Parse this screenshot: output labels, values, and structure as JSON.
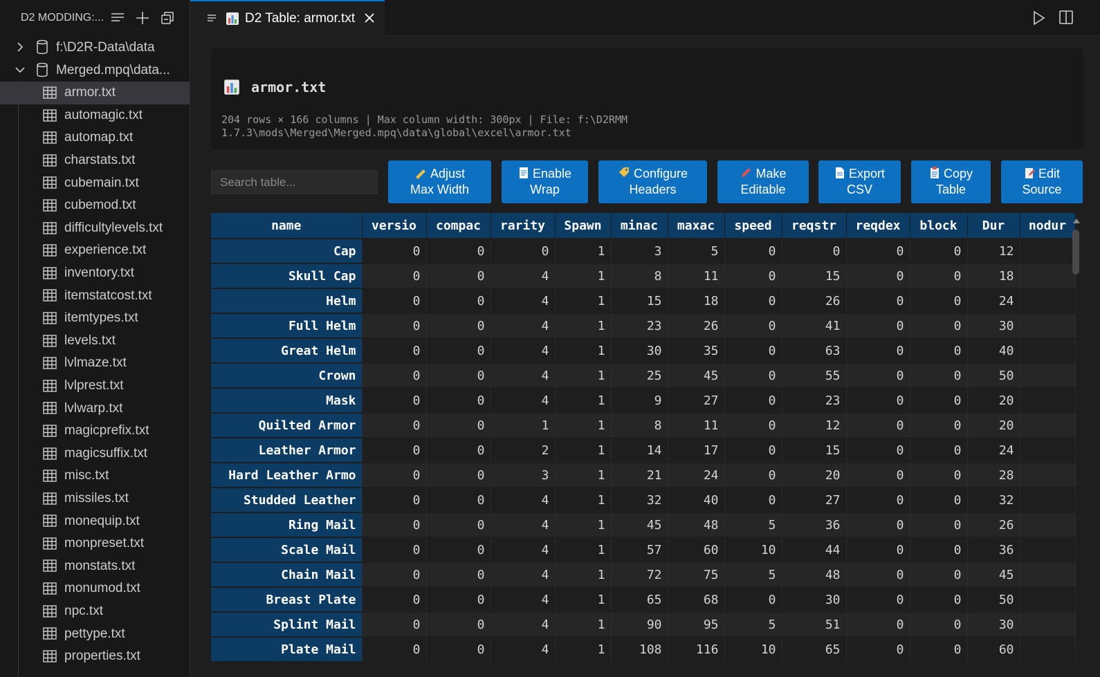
{
  "sidebar": {
    "title": "D2 MODDING:...",
    "roots": [
      {
        "label": "f:\\D2R-Data\\data",
        "expanded": false
      },
      {
        "label": "Merged.mpq\\data...",
        "expanded": true
      }
    ],
    "files": [
      "armor.txt",
      "automagic.txt",
      "automap.txt",
      "charstats.txt",
      "cubemain.txt",
      "cubemod.txt",
      "difficultylevels.txt",
      "experience.txt",
      "inventory.txt",
      "itemstatcost.txt",
      "itemtypes.txt",
      "levels.txt",
      "lvlmaze.txt",
      "lvlprest.txt",
      "lvlwarp.txt",
      "magicprefix.txt",
      "magicsuffix.txt",
      "misc.txt",
      "missiles.txt",
      "monequip.txt",
      "monpreset.txt",
      "monstats.txt",
      "monumod.txt",
      "npc.txt",
      "pettype.txt",
      "properties.txt"
    ],
    "selected": "armor.txt"
  },
  "tab": {
    "label": "D2 Table: armor.txt"
  },
  "info": {
    "title": "armor.txt",
    "meta_line1": "204 rows × 166 columns | Max column width: 300px | File: f:\\D2RMM",
    "meta_line2": "1.7.3\\mods\\Merged\\Merged.mpq\\data\\global\\excel\\armor.txt"
  },
  "search": {
    "placeholder": "Search table..."
  },
  "buttons": [
    {
      "line1": "Adjust",
      "line2": "Max Width"
    },
    {
      "line1": "Enable",
      "line2": "Wrap"
    },
    {
      "line1": "Configure",
      "line2": "Headers"
    },
    {
      "line1": "Make",
      "line2": "Editable"
    },
    {
      "line1": "Export",
      "line2": "CSV"
    },
    {
      "line1": "Copy",
      "line2": "Table"
    },
    {
      "line1": "Edit",
      "line2": "Source"
    }
  ],
  "table": {
    "headers": [
      "name",
      "versio",
      "compac",
      "rarity",
      "Spawn",
      "minac",
      "maxac",
      "speed",
      "reqstr",
      "reqdex",
      "block",
      "Dur",
      "nodur"
    ],
    "rows": [
      [
        "Cap",
        "0",
        "0",
        "0",
        "1",
        "3",
        "5",
        "0",
        "0",
        "0",
        "0",
        "12",
        ""
      ],
      [
        "Skull Cap",
        "0",
        "0",
        "4",
        "1",
        "8",
        "11",
        "0",
        "15",
        "0",
        "0",
        "18",
        ""
      ],
      [
        "Helm",
        "0",
        "0",
        "4",
        "1",
        "15",
        "18",
        "0",
        "26",
        "0",
        "0",
        "24",
        ""
      ],
      [
        "Full Helm",
        "0",
        "0",
        "4",
        "1",
        "23",
        "26",
        "0",
        "41",
        "0",
        "0",
        "30",
        ""
      ],
      [
        "Great Helm",
        "0",
        "0",
        "4",
        "1",
        "30",
        "35",
        "0",
        "63",
        "0",
        "0",
        "40",
        ""
      ],
      [
        "Crown",
        "0",
        "0",
        "4",
        "1",
        "25",
        "45",
        "0",
        "55",
        "0",
        "0",
        "50",
        ""
      ],
      [
        "Mask",
        "0",
        "0",
        "4",
        "1",
        "9",
        "27",
        "0",
        "23",
        "0",
        "0",
        "20",
        ""
      ],
      [
        "Quilted Armor",
        "0",
        "0",
        "1",
        "1",
        "8",
        "11",
        "0",
        "12",
        "0",
        "0",
        "20",
        ""
      ],
      [
        "Leather Armor",
        "0",
        "0",
        "2",
        "1",
        "14",
        "17",
        "0",
        "15",
        "0",
        "0",
        "24",
        ""
      ],
      [
        "Hard Leather Armo",
        "0",
        "0",
        "3",
        "1",
        "21",
        "24",
        "0",
        "20",
        "0",
        "0",
        "28",
        ""
      ],
      [
        "Studded Leather",
        "0",
        "0",
        "4",
        "1",
        "32",
        "40",
        "0",
        "27",
        "0",
        "0",
        "32",
        ""
      ],
      [
        "Ring Mail",
        "0",
        "0",
        "4",
        "1",
        "45",
        "48",
        "5",
        "36",
        "0",
        "0",
        "26",
        ""
      ],
      [
        "Scale Mail",
        "0",
        "0",
        "4",
        "1",
        "57",
        "60",
        "10",
        "44",
        "0",
        "0",
        "36",
        ""
      ],
      [
        "Chain Mail",
        "0",
        "0",
        "4",
        "1",
        "72",
        "75",
        "5",
        "48",
        "0",
        "0",
        "45",
        ""
      ],
      [
        "Breast Plate",
        "0",
        "0",
        "4",
        "1",
        "65",
        "68",
        "0",
        "30",
        "0",
        "0",
        "50",
        ""
      ],
      [
        "Splint Mail",
        "0",
        "0",
        "4",
        "1",
        "90",
        "95",
        "5",
        "51",
        "0",
        "0",
        "30",
        ""
      ],
      [
        "Plate Mail",
        "0",
        "0",
        "4",
        "1",
        "108",
        "116",
        "10",
        "65",
        "0",
        "0",
        "60",
        ""
      ]
    ]
  },
  "colors": {
    "accent": "#0e70c0",
    "header_bg": "#0c3b63",
    "tab_border": "#0078d4"
  }
}
